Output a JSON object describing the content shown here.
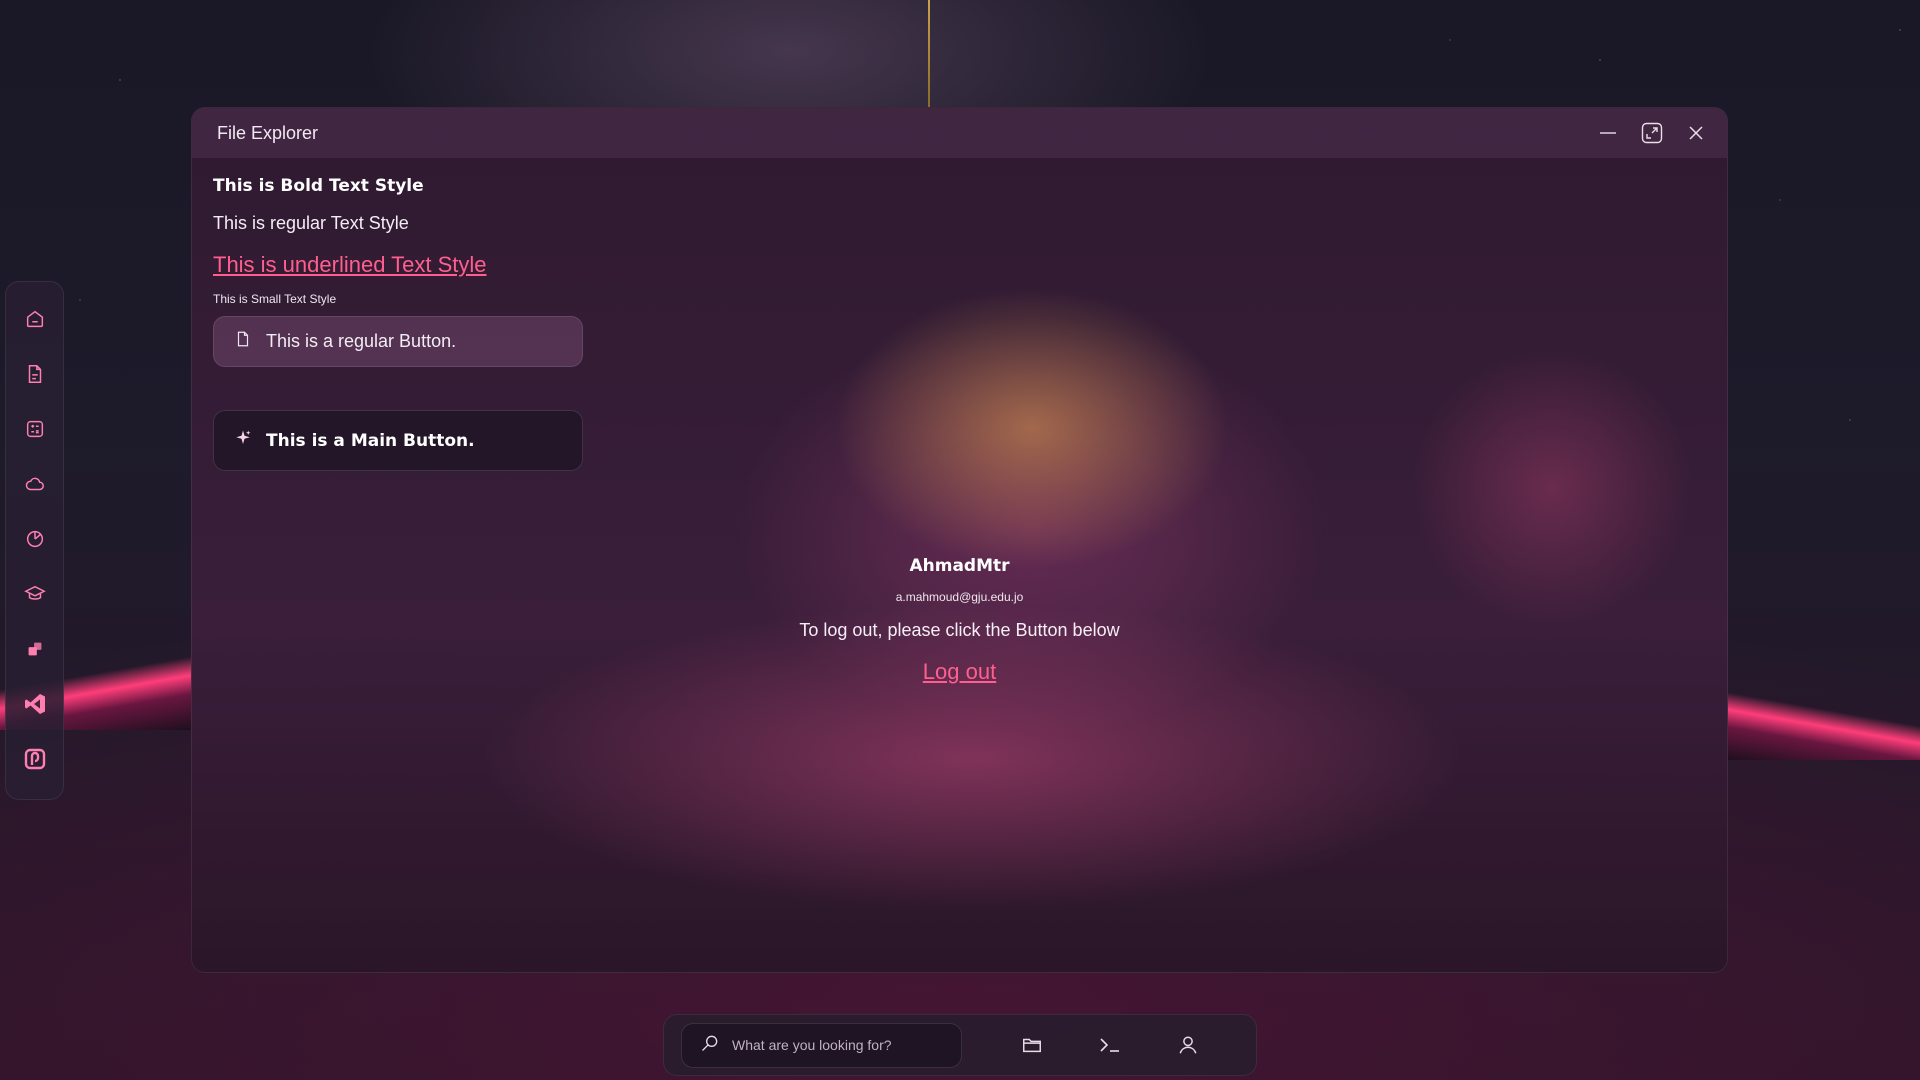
{
  "window": {
    "title": "File Explorer",
    "controls": [
      "minimize-icon",
      "maximize-icon",
      "close-icon"
    ]
  },
  "content": {
    "bold_text": "This is Bold Text Style",
    "regular_text": "This is regular Text Style",
    "underlined_text": "This is underlined Text Style",
    "small_text": "This is Small Text Style",
    "regular_button": {
      "label": "This is a regular Button.",
      "icon": "file-icon"
    },
    "main_button": {
      "label": "This is a Main Button.",
      "icon": "sparkle-icon"
    }
  },
  "profile": {
    "name": "AhmadMtr",
    "email": "a.mahmoud@gju.edu.jo",
    "message": "To log out, please click the Button below",
    "logout_label": "Log out"
  },
  "dock": {
    "items": [
      "home-icon",
      "document-icon",
      "calculator-icon",
      "cloud-icon",
      "chart-icon",
      "graduation-icon",
      "app-icon",
      "vscode-icon",
      "app2-icon"
    ]
  },
  "taskbar": {
    "search_placeholder": "What are you looking for?",
    "icons": [
      "folder-icon",
      "terminal-icon",
      "user-icon"
    ]
  },
  "colors": {
    "accent": "#ff5f8e",
    "dock_icon": "#ff7fb0"
  }
}
